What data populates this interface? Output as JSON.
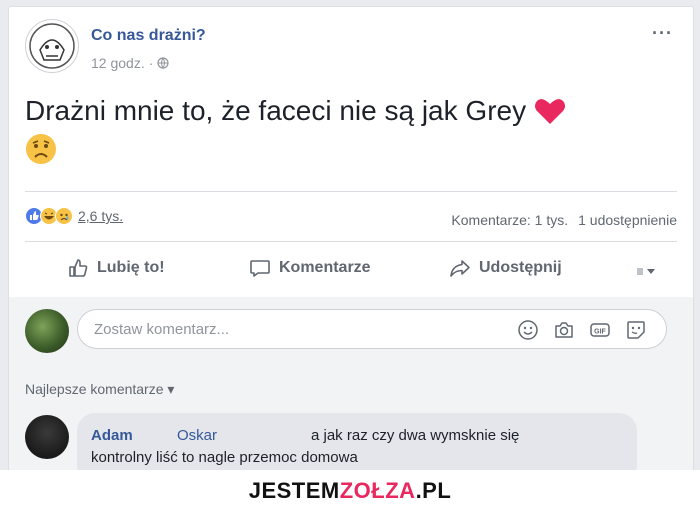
{
  "post": {
    "page_name": "Co nas drażni?",
    "time": "12 godz.",
    "dot": "·",
    "text_main": "Drażni mnie to, że faceci nie są jak Grey",
    "more_icon": "more-dots-icon"
  },
  "stats": {
    "reactions_count": "2,6 tys.",
    "comments": "Komentarze: 1 tys.",
    "shares": "1 udostępnienie"
  },
  "actions": {
    "like": "Lubię to!",
    "comment": "Komentarze",
    "share": "Udostępnij"
  },
  "comments": {
    "placeholder": "Zostaw komentarz...",
    "sort": "Najlepsze komentarze ▾",
    "first": {
      "author": "Adam",
      "tag": "Oskar",
      "line1": "a jak raz czy dwa wymsknie się",
      "line2": "kontrolny liść to nagle przemoc domowa"
    }
  },
  "footer": {
    "part1": "JESTEM",
    "part2": "ZOŁZA",
    "part3": ".PL"
  },
  "colors": {
    "link": "#365899",
    "muted": "#606770",
    "heart": "#e8285f"
  }
}
